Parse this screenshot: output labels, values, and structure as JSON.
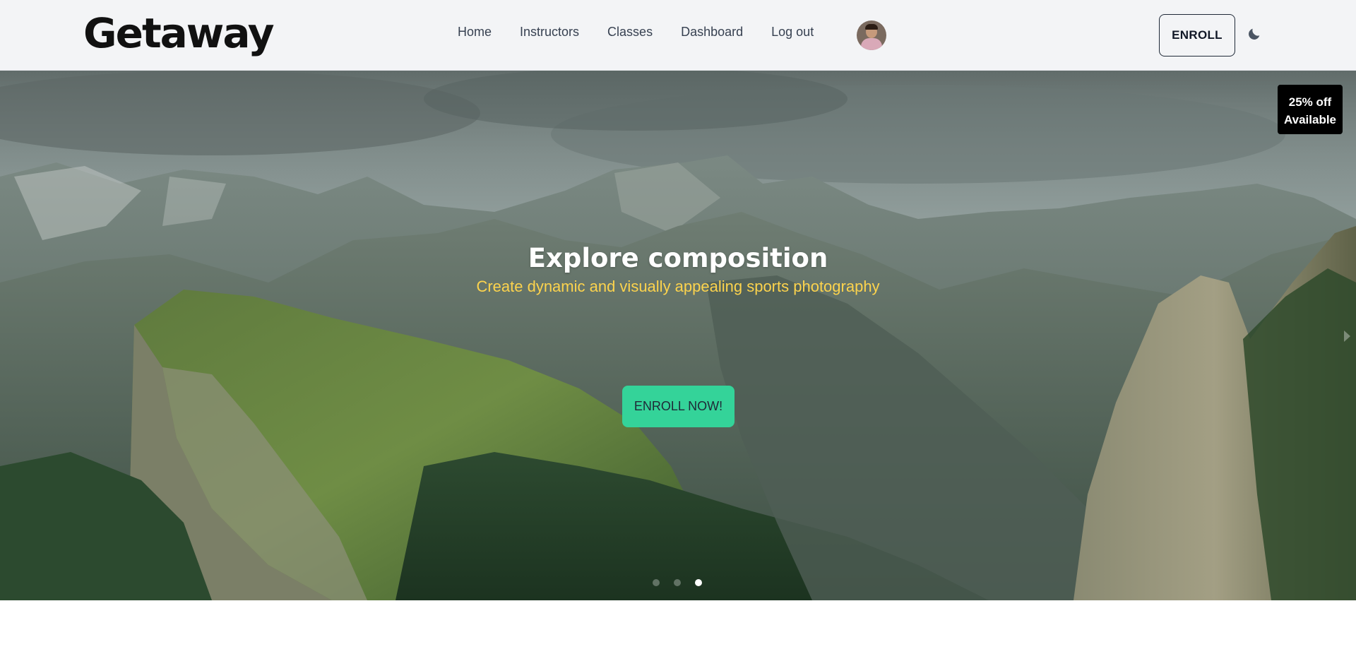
{
  "brand": {
    "logo": "Getaway"
  },
  "nav": {
    "links": [
      {
        "label": "Home"
      },
      {
        "label": "Instructors"
      },
      {
        "label": "Classes"
      },
      {
        "label": "Dashboard"
      },
      {
        "label": "Log out"
      }
    ],
    "enroll_label": "ENROLL",
    "theme_toggle_icon": "moon-icon"
  },
  "hero": {
    "badge": {
      "line1": "25% off",
      "line2": "Available"
    },
    "title": "Explore composition",
    "subtitle": "Create dynamic and visually appealing sports photography",
    "cta_label": "ENROLL NOW!",
    "slides_count": 3,
    "active_slide": 3,
    "next_icon": "chevron-right-icon"
  },
  "colors": {
    "navbar_bg": "#f3f4f6",
    "cta_bg": "#34d399",
    "subtitle": "#fcd34d",
    "badge_bg": "#000000"
  }
}
